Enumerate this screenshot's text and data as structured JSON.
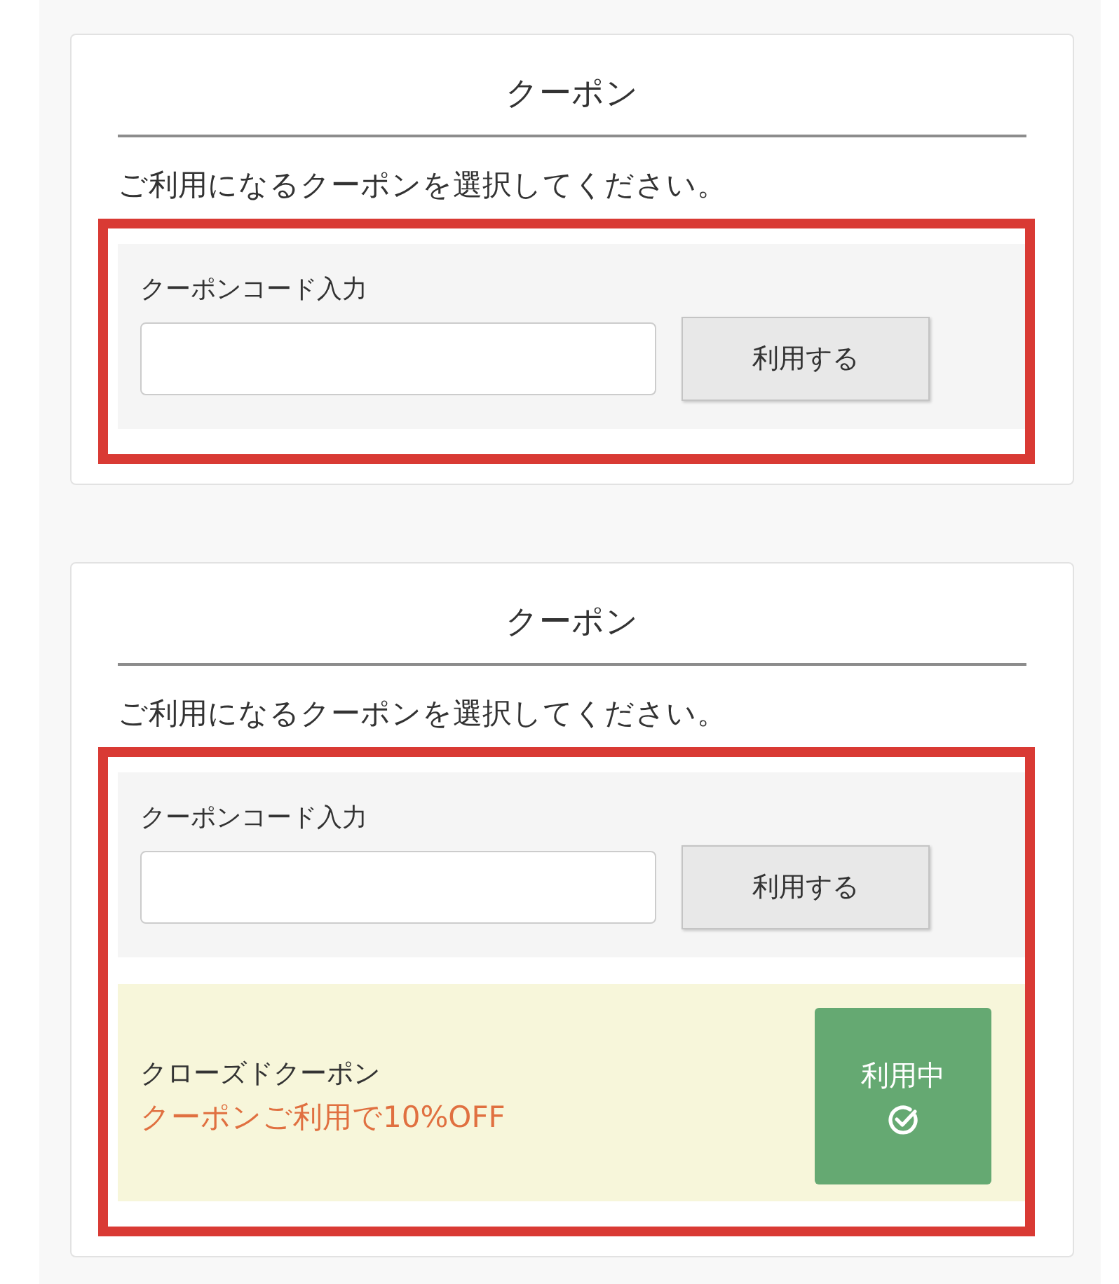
{
  "panels": [
    {
      "title": "クーポン",
      "instruction": "ご利用になるクーポンを選択してください。",
      "highlighted": true,
      "code_entry": {
        "label": "クーポンコード入力",
        "button": "利用する"
      }
    },
    {
      "title": "クーポン",
      "instruction": "ご利用になるクーポンを選択してください。",
      "highlighted": true,
      "code_entry": {
        "label": "クーポンコード入力",
        "button": "利用する"
      },
      "coupons": [
        {
          "name": "クローズドクーポン",
          "description": "クーポンご利用で10%OFF",
          "in_use": true,
          "status": "利用中"
        }
      ]
    }
  ]
}
